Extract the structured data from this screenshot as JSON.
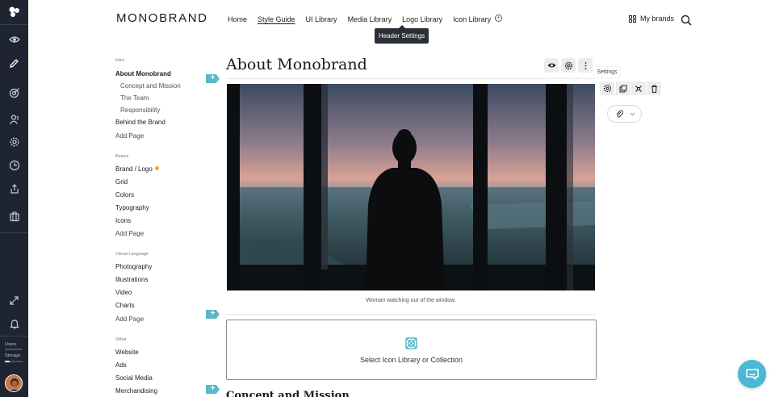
{
  "app": {
    "logo": "MONOBRAND",
    "nav": [
      "Home",
      "Style Guide",
      "UI Library",
      "Media Library",
      "Logo Library",
      "Icon Library"
    ],
    "active_nav": "Style Guide",
    "tooltip": "Header Settings",
    "my_brands": "My brands"
  },
  "rail": {
    "icons": [
      "brand-logo-icon",
      "eye-icon",
      "pencil-icon",
      "target-icon",
      "users-icon",
      "gear-icon",
      "clock-icon",
      "share-icon",
      "briefcase-icon",
      "expand-icon",
      "bell-icon"
    ],
    "users_label": "Users",
    "storage_label": "Storage",
    "storage_fraction": 0.25
  },
  "sidebar": {
    "sections": [
      {
        "title": "Intro",
        "items": [
          {
            "label": "About Monobrand",
            "level": 0,
            "bold": true
          },
          {
            "label": "Concept and Mission",
            "level": 1
          },
          {
            "label": "The Team",
            "level": 1
          },
          {
            "label": "Responsibility",
            "level": 1
          },
          {
            "label": "Behind the Brand",
            "level": 0
          }
        ],
        "add_label": "Add Page"
      },
      {
        "title": "Basics",
        "items": [
          {
            "label": "Brand / Logo",
            "level": 0,
            "dot": true
          },
          {
            "label": "Grid",
            "level": 0
          },
          {
            "label": "Colors",
            "level": 0
          },
          {
            "label": "Typography",
            "level": 0
          },
          {
            "label": "Icons",
            "level": 0
          }
        ],
        "add_label": "Add Page"
      },
      {
        "title": "Visual Language",
        "items": [
          {
            "label": "Photography",
            "level": 0
          },
          {
            "label": "Illustrations",
            "level": 0
          },
          {
            "label": "Video",
            "level": 0
          },
          {
            "label": "Charts",
            "level": 0
          }
        ],
        "add_label": "Add Page"
      },
      {
        "title": "Other",
        "items": [
          {
            "label": "Website",
            "level": 0
          },
          {
            "label": "Ads",
            "level": 0
          },
          {
            "label": "Social Media",
            "level": 0
          },
          {
            "label": "Merchandising",
            "level": 0
          }
        ]
      }
    ]
  },
  "main": {
    "page_title": "About Monobrand",
    "settings_tooltip": "Settings",
    "image_caption": "Woman watching out of the window.",
    "icon_block_label": "Select Icon Library or Collection",
    "next_heading": "Concept and Mission"
  },
  "colors": {
    "accent": "#5ab8c8",
    "rail": "#1f2530",
    "chat": "#4ab8d4",
    "status_dot": "#f5a623"
  }
}
